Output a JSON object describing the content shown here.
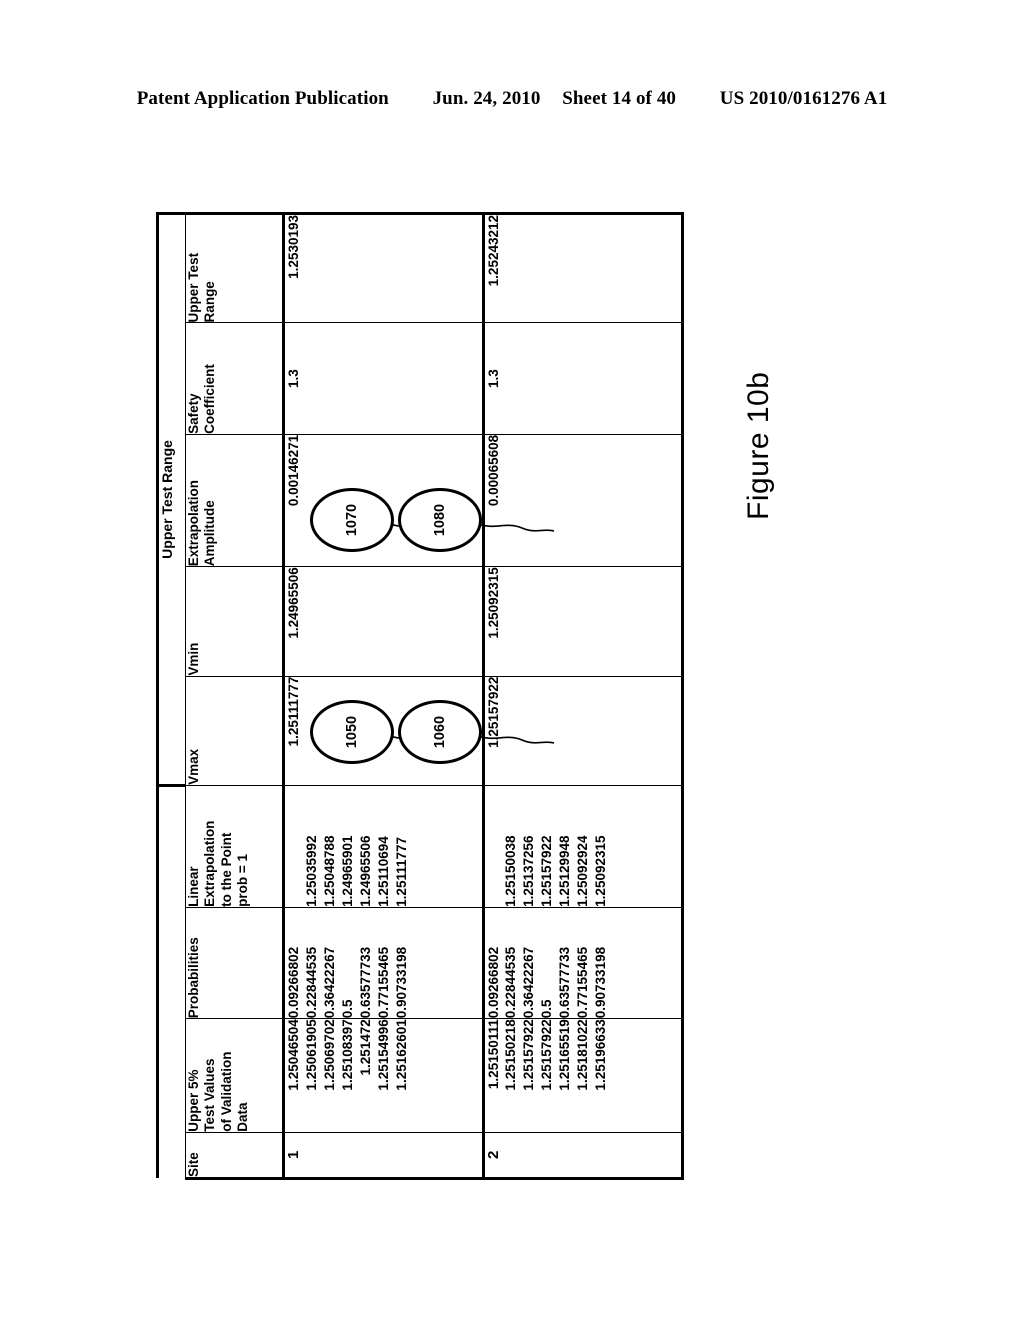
{
  "header": {
    "publication": "Patent Application Publication",
    "date": "Jun. 24, 2010",
    "sheet": "Sheet 14 of 40",
    "patent_number": "US 2010/0161276 A1"
  },
  "figure": {
    "caption": "Figure 10b",
    "table_title": "Upper Test Range"
  },
  "table": {
    "columns": {
      "site": "Site",
      "test_values": "Upper 5%\nTest Values\nof Validation\nData",
      "test_values_l1": "Upper 5%",
      "test_values_l2": "Test Values",
      "test_values_l3": "of Validation",
      "test_values_l4": "Data",
      "probabilities": "Probabilities",
      "linear_extrapolation_l1": "Linear",
      "linear_extrapolation_l2": "Extrapolation",
      "linear_extrapolation_l3": "to the Point",
      "linear_extrapolation_l4": "prob = 1",
      "vmax": "Vmax",
      "vmin": "Vmin",
      "extrapolation_amplitude_l1": "Extrapolation",
      "extrapolation_amplitude_l2": "Amplitude",
      "safety_coefficient_l1": "Safety",
      "safety_coefficient_l2": "Coefficient",
      "upper_test_range_l1": "Upper Test",
      "upper_test_range_l2": "Range"
    },
    "rows": [
      {
        "site": "1",
        "test_values": [
          "1.25046504",
          "1.25061905",
          "1.25069702",
          "1.25108397",
          "1.251472",
          "1.25154996",
          "1.25162601"
        ],
        "probabilities": [
          "0.09266802",
          "0.22844535",
          "0.36422267",
          "0.5",
          "0.63577733",
          "0.77155465",
          "0.90733198"
        ],
        "linear_extrapolation": [
          "",
          "1.25035992",
          "1.25048788",
          "1.24965901",
          "1.24965506",
          "1.25110694",
          "1.25111777"
        ],
        "vmax": "1.25111777",
        "vmin": "1.24965506",
        "extrapolation_amplitude": "0.00146271",
        "safety_coefficient": "1.3",
        "upper_test_range": "1.2530193"
      },
      {
        "site": "2",
        "test_values": [
          "1.25150111",
          "1.25150218",
          "1.25157922",
          "1.25157922",
          "1.25165519",
          "1.25181022",
          "1.25196633"
        ],
        "probabilities": [
          "0.09266802",
          "0.22844535",
          "0.36422267",
          "0.5",
          "0.63577733",
          "0.77155465",
          "0.90733198"
        ],
        "linear_extrapolation": [
          "",
          "1.25150038",
          "1.25137256",
          "1.25157922",
          "1.25129948",
          "1.25092924",
          "1.25092315"
        ],
        "vmax": "1.25157922",
        "vmin": "1.25092315",
        "extrapolation_amplitude": "0.00065608",
        "safety_coefficient": "1.3",
        "upper_test_range": "1.25243212"
      }
    ]
  },
  "callouts": [
    {
      "label": "1050"
    },
    {
      "label": "1060"
    },
    {
      "label": "1070"
    },
    {
      "label": "1080"
    }
  ]
}
